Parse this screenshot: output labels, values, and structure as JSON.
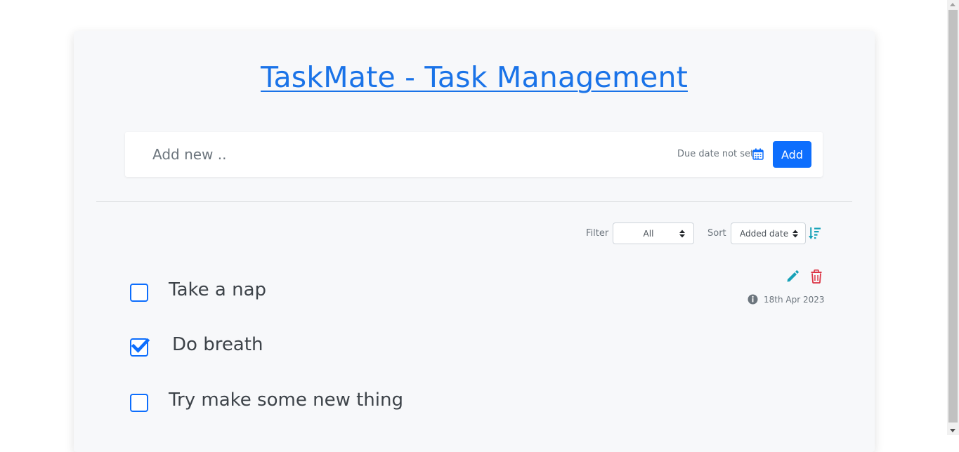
{
  "header": {
    "title": "TaskMate - Task Management"
  },
  "add_form": {
    "placeholder": "Add new ..",
    "due_date_label": "Due date not set",
    "add_label": "Add"
  },
  "controls": {
    "filter_label": "Filter",
    "filter_value": "All",
    "sort_label": "Sort",
    "sort_value": "Added date"
  },
  "tasks": [
    {
      "text": "Take a nap",
      "done": false,
      "date": "18th Apr 2023"
    },
    {
      "text": "Do breath",
      "done": true
    },
    {
      "text": "Try make some new thing",
      "done": false
    }
  ],
  "colors": {
    "primary": "#0d6efd",
    "title_link": "#1a73e8",
    "edit": "#17a2b8",
    "delete": "#dc3545"
  },
  "icons": [
    "calendar-icon",
    "updown-icon",
    "sort-descending-icon",
    "pencil-icon",
    "trash-icon",
    "info-icon",
    "check-icon"
  ]
}
